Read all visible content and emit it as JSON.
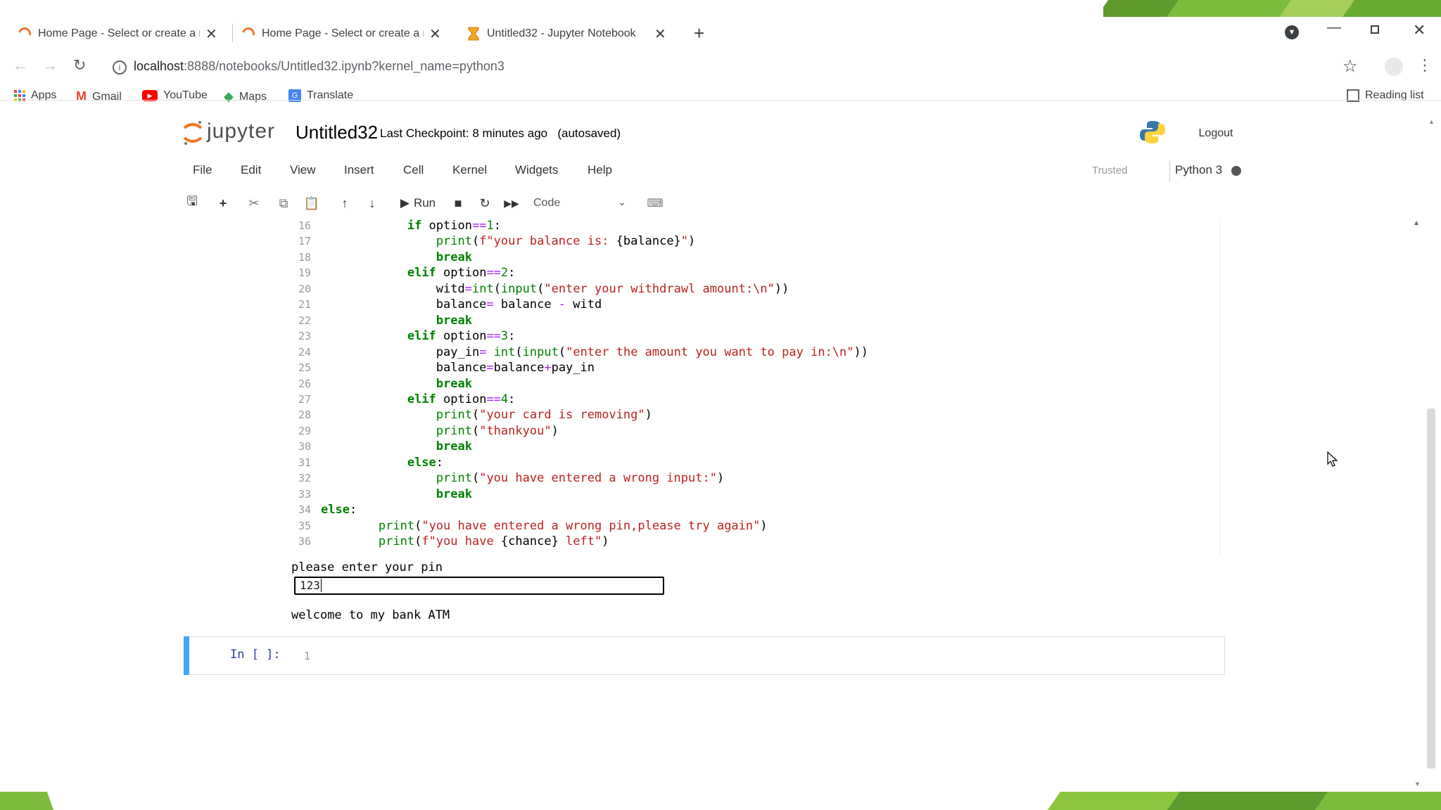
{
  "browser": {
    "tabs": [
      {
        "title": "Home Page - Select or create a n",
        "icon": "jupyter-spinner-icon"
      },
      {
        "title": "Home Page - Select or create a n",
        "icon": "jupyter-spinner-icon"
      },
      {
        "title": "Untitled32 - Jupyter Notebook",
        "icon": "hourglass-icon",
        "active": true
      }
    ],
    "url_host": "localhost",
    "url_rest": ":8888/notebooks/Untitled32.ipynb?kernel_name=python3",
    "bookmarks": [
      {
        "label": "Apps",
        "icon": "apps-grid-icon"
      },
      {
        "label": "Gmail",
        "icon": "gmail-icon"
      },
      {
        "label": "YouTube",
        "icon": "youtube-icon"
      },
      {
        "label": "Maps",
        "icon": "maps-icon"
      },
      {
        "label": "Translate",
        "icon": "translate-icon"
      }
    ],
    "reading_list": "Reading list"
  },
  "jupyter": {
    "logo_text": "jupyter",
    "notebook_name": "Untitled32",
    "checkpoint": "Last Checkpoint: 8 minutes ago",
    "autosave": "(autosaved)",
    "logout": "Logout",
    "menu": [
      "File",
      "Edit",
      "View",
      "Insert",
      "Cell",
      "Kernel",
      "Widgets",
      "Help"
    ],
    "trusted": "Trusted",
    "kernel_name": "Python 3",
    "toolbar": {
      "run_label": "Run",
      "cell_type": "Code"
    }
  },
  "code_lines": [
    {
      "n": "16",
      "indent": 12,
      "tokens": [
        [
          "kw",
          "if"
        ],
        [
          "tx",
          " option"
        ],
        [
          "op",
          "=="
        ],
        [
          "nm",
          "1"
        ],
        [
          "tx",
          ":"
        ]
      ]
    },
    {
      "n": "17",
      "indent": 16,
      "tokens": [
        [
          "bi",
          "print"
        ],
        [
          "tx",
          "("
        ],
        [
          "st",
          "f\"your balance is: "
        ],
        [
          "tx",
          "{balance}"
        ],
        [
          "st",
          "\""
        ],
        [
          "tx",
          ")"
        ]
      ]
    },
    {
      "n": "18",
      "indent": 16,
      "tokens": [
        [
          "kw",
          "break"
        ]
      ]
    },
    {
      "n": "19",
      "indent": 12,
      "tokens": [
        [
          "kw",
          "elif"
        ],
        [
          "tx",
          " option"
        ],
        [
          "op",
          "=="
        ],
        [
          "nm",
          "2"
        ],
        [
          "tx",
          ":"
        ]
      ]
    },
    {
      "n": "20",
      "indent": 16,
      "tokens": [
        [
          "tx",
          "witd"
        ],
        [
          "op",
          "="
        ],
        [
          "bi",
          "int"
        ],
        [
          "tx",
          "("
        ],
        [
          "bi",
          "input"
        ],
        [
          "tx",
          "("
        ],
        [
          "st",
          "\"enter your withdrawl amount:\\n\""
        ],
        [
          "tx",
          "))"
        ]
      ]
    },
    {
      "n": "21",
      "indent": 16,
      "tokens": [
        [
          "tx",
          "balance"
        ],
        [
          "op",
          "="
        ],
        [
          "tx",
          " balance "
        ],
        [
          "op",
          "-"
        ],
        [
          "tx",
          " witd"
        ]
      ]
    },
    {
      "n": "22",
      "indent": 16,
      "tokens": [
        [
          "kw",
          "break"
        ]
      ]
    },
    {
      "n": "23",
      "indent": 12,
      "tokens": [
        [
          "kw",
          "elif"
        ],
        [
          "tx",
          " option"
        ],
        [
          "op",
          "=="
        ],
        [
          "nm",
          "3"
        ],
        [
          "tx",
          ":"
        ]
      ]
    },
    {
      "n": "24",
      "indent": 16,
      "tokens": [
        [
          "tx",
          "pay_in"
        ],
        [
          "op",
          "="
        ],
        [
          "tx",
          " "
        ],
        [
          "bi",
          "int"
        ],
        [
          "tx",
          "("
        ],
        [
          "bi",
          "input"
        ],
        [
          "tx",
          "("
        ],
        [
          "st",
          "\"enter the amount you want to pay in:\\n\""
        ],
        [
          "tx",
          "))"
        ]
      ]
    },
    {
      "n": "25",
      "indent": 16,
      "tokens": [
        [
          "tx",
          "balance"
        ],
        [
          "op",
          "="
        ],
        [
          "tx",
          "balance"
        ],
        [
          "op",
          "+"
        ],
        [
          "tx",
          "pay_in"
        ]
      ]
    },
    {
      "n": "26",
      "indent": 16,
      "tokens": [
        [
          "kw",
          "break"
        ]
      ]
    },
    {
      "n": "27",
      "indent": 12,
      "tokens": [
        [
          "kw",
          "elif"
        ],
        [
          "tx",
          " option"
        ],
        [
          "op",
          "=="
        ],
        [
          "nm",
          "4"
        ],
        [
          "tx",
          ":"
        ]
      ]
    },
    {
      "n": "28",
      "indent": 16,
      "tokens": [
        [
          "bi",
          "print"
        ],
        [
          "tx",
          "("
        ],
        [
          "st",
          "\"your card is removing\""
        ],
        [
          "tx",
          ")"
        ]
      ]
    },
    {
      "n": "29",
      "indent": 16,
      "tokens": [
        [
          "bi",
          "print"
        ],
        [
          "tx",
          "("
        ],
        [
          "st",
          "\"thankyou\""
        ],
        [
          "tx",
          ")"
        ]
      ]
    },
    {
      "n": "30",
      "indent": 16,
      "tokens": [
        [
          "kw",
          "break"
        ]
      ]
    },
    {
      "n": "31",
      "indent": 12,
      "tokens": [
        [
          "kw",
          "else"
        ],
        [
          "tx",
          ":"
        ]
      ]
    },
    {
      "n": "32",
      "indent": 16,
      "tokens": [
        [
          "bi",
          "print"
        ],
        [
          "tx",
          "("
        ],
        [
          "st",
          "\"you have entered a wrong input:\""
        ],
        [
          "tx",
          ")"
        ]
      ]
    },
    {
      "n": "33",
      "indent": 16,
      "tokens": [
        [
          "kw",
          "break"
        ]
      ]
    },
    {
      "n": "34",
      "indent": 0,
      "tokens": [
        [
          "kw",
          "else"
        ],
        [
          "tx",
          ":"
        ]
      ]
    },
    {
      "n": "35",
      "indent": 8,
      "tokens": [
        [
          "bi",
          "print"
        ],
        [
          "tx",
          "("
        ],
        [
          "st",
          "\"you have entered a wrong pin,please try again\""
        ],
        [
          "tx",
          ")"
        ]
      ]
    },
    {
      "n": "36",
      "indent": 8,
      "tokens": [
        [
          "bi",
          "print"
        ],
        [
          "tx",
          "("
        ],
        [
          "st",
          "f\"you have "
        ],
        [
          "tx",
          "{chance}"
        ],
        [
          "st",
          " left\""
        ],
        [
          "tx",
          ")"
        ]
      ]
    }
  ],
  "output": {
    "prompt_text": "please enter your pin",
    "pin_value": "123",
    "welcome": "welcome to my bank ATM"
  },
  "new_cell": {
    "prompt": "In [ ]:",
    "line_number": "1"
  },
  "colors": {
    "keyword": "#008000",
    "string": "#ba2121",
    "operator": "#aa22ff",
    "cell_selected": "#42a5f5",
    "jupyter_orange": "#f37626"
  }
}
